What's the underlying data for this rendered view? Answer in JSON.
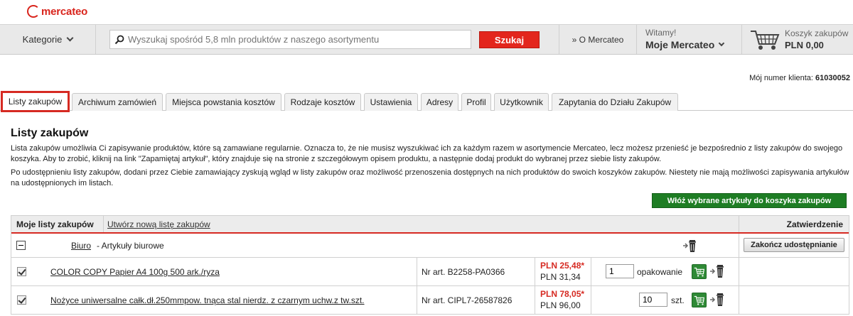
{
  "logo": {
    "text": "mercateo"
  },
  "header": {
    "categories_label": "Kategorie",
    "search_placeholder": "Wyszukaj spośród 5,8 mln produktów z naszego asortymentu",
    "search_button": "Szukaj",
    "about_link": "» O Mercateo",
    "greeting": "Witamy!",
    "account_name": "Moje Mercateo",
    "cart_label": "Koszyk zakupów",
    "cart_value": "PLN 0,00"
  },
  "client": {
    "label": "Mój numer klienta:",
    "number": "61030052"
  },
  "tabs": [
    {
      "label": "Listy zakupów",
      "active": true
    },
    {
      "label": "Archiwum zamówień"
    },
    {
      "label": "Miejsca powstania kosztów"
    },
    {
      "label": "Rodzaje kosztów"
    },
    {
      "label": "Ustawienia"
    },
    {
      "label": "Adresy"
    },
    {
      "label": "Profil"
    },
    {
      "label": "Użytkownik"
    },
    {
      "label": "Zapytania do Działu Zakupów"
    }
  ],
  "page": {
    "title": "Listy zakupów",
    "desc1": "Lista zakupów umożliwia Ci zapisywanie produktów, które są zamawiane regularnie. Oznacza to, że nie musisz wyszukiwać ich za każdym razem w asortymencie Mercateo, lecz możesz przenieść je bezpośrednio z listy zakupów do swojego koszyka. Aby to zrobić, kliknij na link \"Zapamiętaj artykuł\", który znajduje się na stronie z szczegółowym opisem produktu, a następnie dodaj produkt do wybranej przez siebie listy zakupów.",
    "desc2": "Po udostępnieniu listy zakupów, dodani przez Ciebie zamawiający zyskują wgląd w listy zakupów oraz możliwość przenoszenia dostępnych na nich produktów do swoich koszyków zakupów. Niestety nie mają możliwości zapisywania artykułów na udostępnionych im listach.",
    "add_to_cart_button": "Włóż wybrane artykuły do koszyka zakupów"
  },
  "table": {
    "header_my_lists": "Moje listy zakupów",
    "header_new_list": "Utwórz nową listę zakupów",
    "header_approval": "Zatwierdzenie",
    "group": {
      "name": "Biuro",
      "description": "- Artykuły biurowe",
      "end_share_button": "Zakończ udostępnianie"
    },
    "items": [
      {
        "checked": true,
        "name": "COLOR COPY Papier A4 100g 500 ark./ryza",
        "art_no": "Nr art. B2258-PA0366",
        "price_net": "PLN 25,48*",
        "price_gross": "PLN 31,34",
        "qty": "1",
        "unit": "opakowanie"
      },
      {
        "checked": true,
        "name": "Nożyce uniwersalne całk.dł.250mmpow. tnąca stal nierdz. z czarnym uchw.z tw.szt.",
        "art_no": "Nr art. CIPL7-26587826",
        "price_net": "PLN 78,05*",
        "price_gross": "PLN 96,00",
        "qty": "10",
        "unit": "szt."
      }
    ]
  },
  "colors": {
    "brand_red": "#d62a22",
    "search_red": "#e3261d",
    "green": "#1e7d24"
  }
}
